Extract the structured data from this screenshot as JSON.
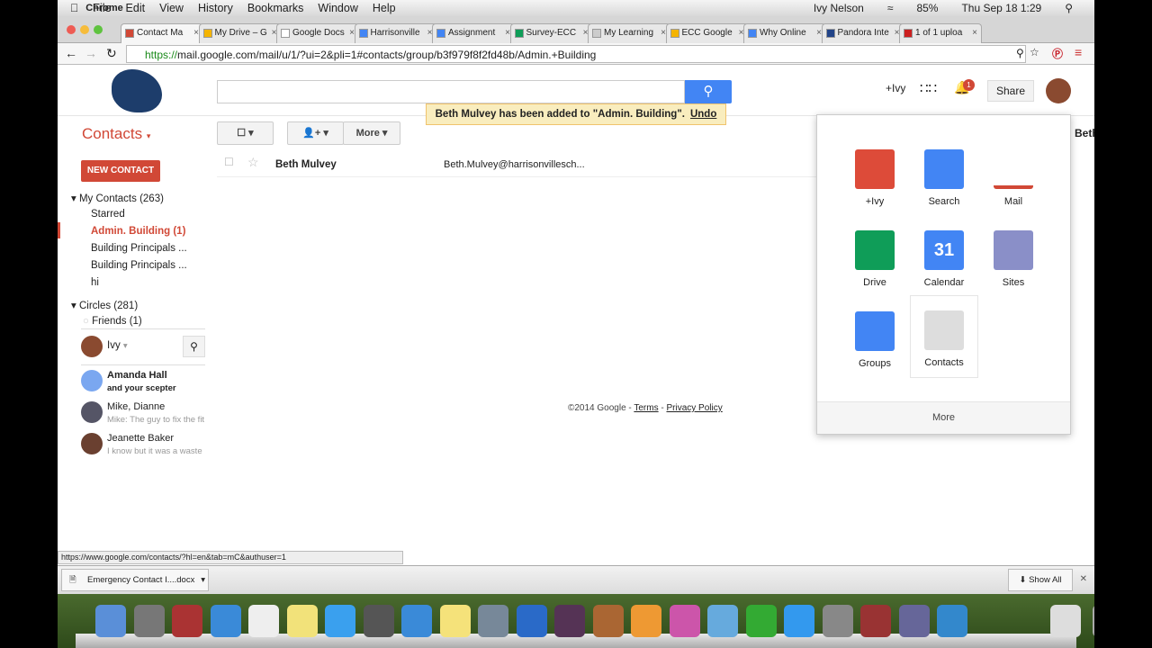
{
  "menubar": {
    "app": "Chrome",
    "items": [
      "File",
      "Edit",
      "View",
      "History",
      "Bookmarks",
      "Window",
      "Help"
    ],
    "user": "Ivy Nelson",
    "battery": "85%",
    "datetime": "Thu Sep 18  1:29"
  },
  "tabs": [
    {
      "label": "Contact Ma",
      "color": "#d14836",
      "active": true
    },
    {
      "label": "My Drive – G",
      "color": "#f4b400"
    },
    {
      "label": "Google Docs",
      "color": "#ffffff"
    },
    {
      "label": "Harrisonville",
      "color": "#4285f4"
    },
    {
      "label": "Assignment",
      "color": "#4285f4"
    },
    {
      "label": "Survey-ECC",
      "color": "#0f9d58"
    },
    {
      "label": "My Learning",
      "color": "#cccccc"
    },
    {
      "label": "ECC Google",
      "color": "#f4b400"
    },
    {
      "label": "Why Online",
      "color": "#4285f4"
    },
    {
      "label": "Pandora Inte",
      "color": "#224488"
    },
    {
      "label": "1 of 1 uploa",
      "color": "#cc2020"
    }
  ],
  "address": {
    "scheme": "https://",
    "url": "mail.google.com/mail/u/1/?ui=2&pli=1#contacts/group/b3f979f8f2fd48b/Admin.+Building"
  },
  "header": {
    "plus_user": "+Ivy",
    "notifications": "1",
    "share": "Share"
  },
  "toast": {
    "message": "Beth Mulvey has been added to \"Admin. Building\".",
    "undo": "Undo"
  },
  "contacts": {
    "title": "Contacts",
    "more": "More",
    "new_contact": "NEW CONTACT",
    "peek": "Beth"
  },
  "nav": {
    "my_contacts": "My Contacts (263)",
    "items": [
      "Starred",
      "Admin. Building (1)",
      "Building Principals ...",
      "Building Principals ...",
      "hi"
    ],
    "circles": "Circles (281)",
    "friends": "Friends (1)"
  },
  "chat": {
    "me": "Ivy",
    "items": [
      {
        "name": "Amanda Hall",
        "status": "and your scepter",
        "bold": true
      },
      {
        "name": "Mike, Dianne",
        "status": "Mike: The guy to fix the fit"
      },
      {
        "name": "Jeanette Baker",
        "status": "I know but it was a waste"
      }
    ]
  },
  "row": {
    "name": "Beth Mulvey",
    "email": "Beth.Mulvey@harrisonvillesch..."
  },
  "footer": {
    "copy": "©2014 Google - ",
    "terms": "Terms",
    "sep": " - ",
    "privacy": "Privacy Policy"
  },
  "apps": {
    "items": [
      {
        "label": "+Ivy",
        "icon": "google-plus-icon",
        "color": "#dd4b39"
      },
      {
        "label": "Search",
        "icon": "google-search-icon",
        "color": "#4285f4"
      },
      {
        "label": "Mail",
        "icon": "gmail-icon",
        "color": "#ffffff"
      },
      {
        "label": "Drive",
        "icon": "drive-icon",
        "color": "#0f9d58"
      },
      {
        "label": "Calendar",
        "icon": "calendar-icon",
        "color": "#4285f4",
        "text": "31"
      },
      {
        "label": "Sites",
        "icon": "sites-icon",
        "color": "#8a8fc8"
      },
      {
        "label": "Groups",
        "icon": "groups-icon",
        "color": "#4285f4"
      },
      {
        "label": "Contacts",
        "icon": "contacts-icon",
        "color": "#dddddd"
      }
    ],
    "more": "More"
  },
  "hover_url": "https://www.google.com/contacts/?hl=en&tab=mC&authuser=1",
  "download": {
    "file": "Emergency Contact I....docx",
    "show_all": "Show All"
  }
}
